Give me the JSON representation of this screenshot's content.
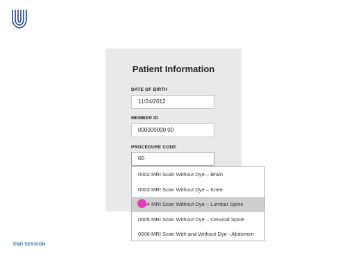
{
  "icons": {
    "logo": "brand-logo-icon"
  },
  "colors": {
    "brand_blue": "#1f3f8f",
    "link_blue": "#2a6ab3",
    "card_background": "#e9e9e9",
    "highlight_row": "#cfcfcf",
    "cursor_marker": "#e632be"
  },
  "form": {
    "title": "Patient Information",
    "date_of_birth": {
      "label": "DATE OF BIRTH",
      "value": "11/24/2012"
    },
    "member_id": {
      "label": "MEMBER ID",
      "value": "000000000 00"
    },
    "procedure_code": {
      "label": "PROCEDURE CODE",
      "value": "00"
    }
  },
  "dropdown": {
    "highlighted_index": 2,
    "options": [
      {
        "label": "0002 MRI Scan Without Dye – Brain"
      },
      {
        "label": "0003 MRI Scan Without Dye – Knee"
      },
      {
        "label": "0004 MRI Scan Without Dye – Lumbar Spine"
      },
      {
        "label": "0005 MRI Scan Without Dye – Cervical Spine"
      },
      {
        "label": "0006 MRI Scan With and Without Dye - Abdomen"
      }
    ]
  },
  "footer": {
    "end_session_label": "END SESSION"
  }
}
